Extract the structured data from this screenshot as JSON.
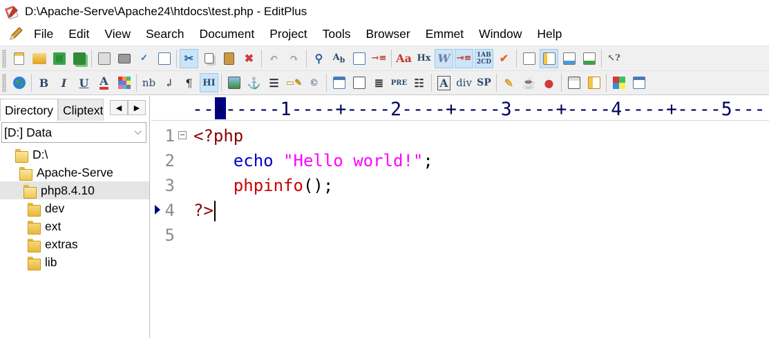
{
  "window": {
    "title": "D:\\Apache-Serve\\Apache24\\htdocs\\test.php - EditPlus"
  },
  "menu": {
    "items": [
      "File",
      "Edit",
      "View",
      "Search",
      "Document",
      "Project",
      "Tools",
      "Browser",
      "Emmet",
      "Window",
      "Help"
    ]
  },
  "toolbar2_glyphs": {
    "bold": "B",
    "italic": "I",
    "underline": "U",
    "font_color": "A",
    "nbsp": "nb",
    "br": "↲",
    "paragraph": "¶",
    "heading": "HI",
    "pre": "PRE",
    "div": "div",
    "span": "SP",
    "hx": "Hx",
    "word_wrap": "W"
  },
  "left_panel": {
    "tabs": [
      "Directory",
      "Cliptext"
    ],
    "drive": "[D:] Data",
    "tree": [
      {
        "label": "D:\\",
        "indent": 0
      },
      {
        "label": "Apache-Serve",
        "indent": 1
      },
      {
        "label": "php8.4.10",
        "indent": 2,
        "selected": true
      },
      {
        "label": "dev",
        "indent": 3
      },
      {
        "label": "ext",
        "indent": 3
      },
      {
        "label": "extras",
        "indent": 3
      },
      {
        "label": "lib",
        "indent": 3
      }
    ]
  },
  "ruler": {
    "text": "--+-----1----+----2----+----3----+----4----+----5---"
  },
  "editor": {
    "line_numbers": [
      "1",
      "2",
      "3",
      "4",
      "5"
    ],
    "current_line": 4,
    "code": {
      "l1_open": "<?php",
      "l2_echo": "echo",
      "l2_string": "\"Hello world!\"",
      "l2_semi": ";",
      "l3_fn": "phpinfo",
      "l3_parens": "();",
      "l4_close": "?>"
    }
  },
  "colors": {
    "tag": "#8b0000",
    "keyword": "#0000cd",
    "string": "#ff00ff",
    "function": "#cc0000",
    "ruler": "#00005e"
  }
}
